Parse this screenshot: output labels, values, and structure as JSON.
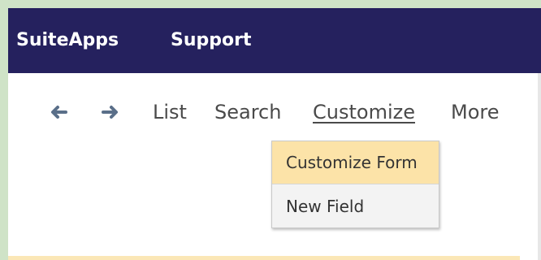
{
  "top_nav": {
    "items": [
      {
        "label": "SuiteApps"
      },
      {
        "label": "Support"
      }
    ]
  },
  "toolbar": {
    "back_icon": "arrow-left-icon",
    "forward_icon": "arrow-right-icon",
    "links": [
      {
        "label": "List"
      },
      {
        "label": "Search"
      },
      {
        "label": "Customize"
      },
      {
        "label": "More"
      }
    ]
  },
  "dropdown": {
    "items": [
      {
        "label": "Customize Form",
        "highlighted": true
      },
      {
        "label": "New Field",
        "highlighted": false
      }
    ]
  },
  "colors": {
    "nav_background": "#25215e",
    "highlight": "#fce3a8",
    "banner": "#fbe7b6",
    "outer_background": "#cfe3c7"
  }
}
